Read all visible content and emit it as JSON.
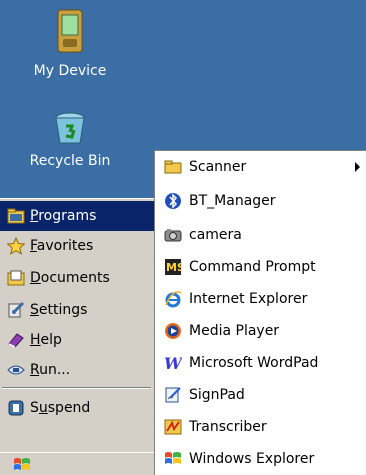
{
  "desktop": {
    "icons": [
      {
        "label": "My Device",
        "icon": "pda-device-icon"
      },
      {
        "label": "Recycle Bin",
        "icon": "recycle-bin-icon"
      }
    ]
  },
  "start_menu": {
    "items": [
      {
        "first": "P",
        "rest": "rograms",
        "icon": "programs-folder-icon",
        "selected": true
      },
      {
        "first": "F",
        "rest": "avorites",
        "prefix": "",
        "icon": "star-icon"
      },
      {
        "first": "D",
        "rest": "ocuments",
        "icon": "documents-folder-icon"
      },
      {
        "first": "S",
        "rest": "ettings",
        "icon": "settings-icon"
      },
      {
        "first": "H",
        "rest": "elp",
        "icon": "help-book-icon"
      },
      {
        "first": "R",
        "rest": "un...",
        "icon": "run-icon"
      },
      {
        "prefix": "S",
        "first": "u",
        "rest": "spend",
        "icon": "suspend-icon"
      }
    ]
  },
  "programs_submenu": {
    "items": [
      {
        "label": "Scanner",
        "icon": "folder-icon",
        "has_submenu": true
      },
      {
        "label": "BT_Manager",
        "icon": "bluetooth-icon"
      },
      {
        "label": "camera",
        "icon": "camera-icon"
      },
      {
        "label": "Command Prompt",
        "icon": "command-prompt-icon"
      },
      {
        "label": "Internet Explorer",
        "icon": "internet-explorer-icon"
      },
      {
        "label": "Media Player",
        "icon": "media-player-icon"
      },
      {
        "label": "Microsoft WordPad",
        "icon": "wordpad-icon"
      },
      {
        "label": "SignPad",
        "icon": "signpad-icon"
      },
      {
        "label": "Transcriber",
        "icon": "transcriber-icon"
      },
      {
        "label": "Windows Explorer",
        "icon": "windows-explorer-icon"
      }
    ]
  },
  "colors": {
    "desktop": "#3a6ea5",
    "menu": "#d4d0c8",
    "selection": "#0a246a"
  }
}
